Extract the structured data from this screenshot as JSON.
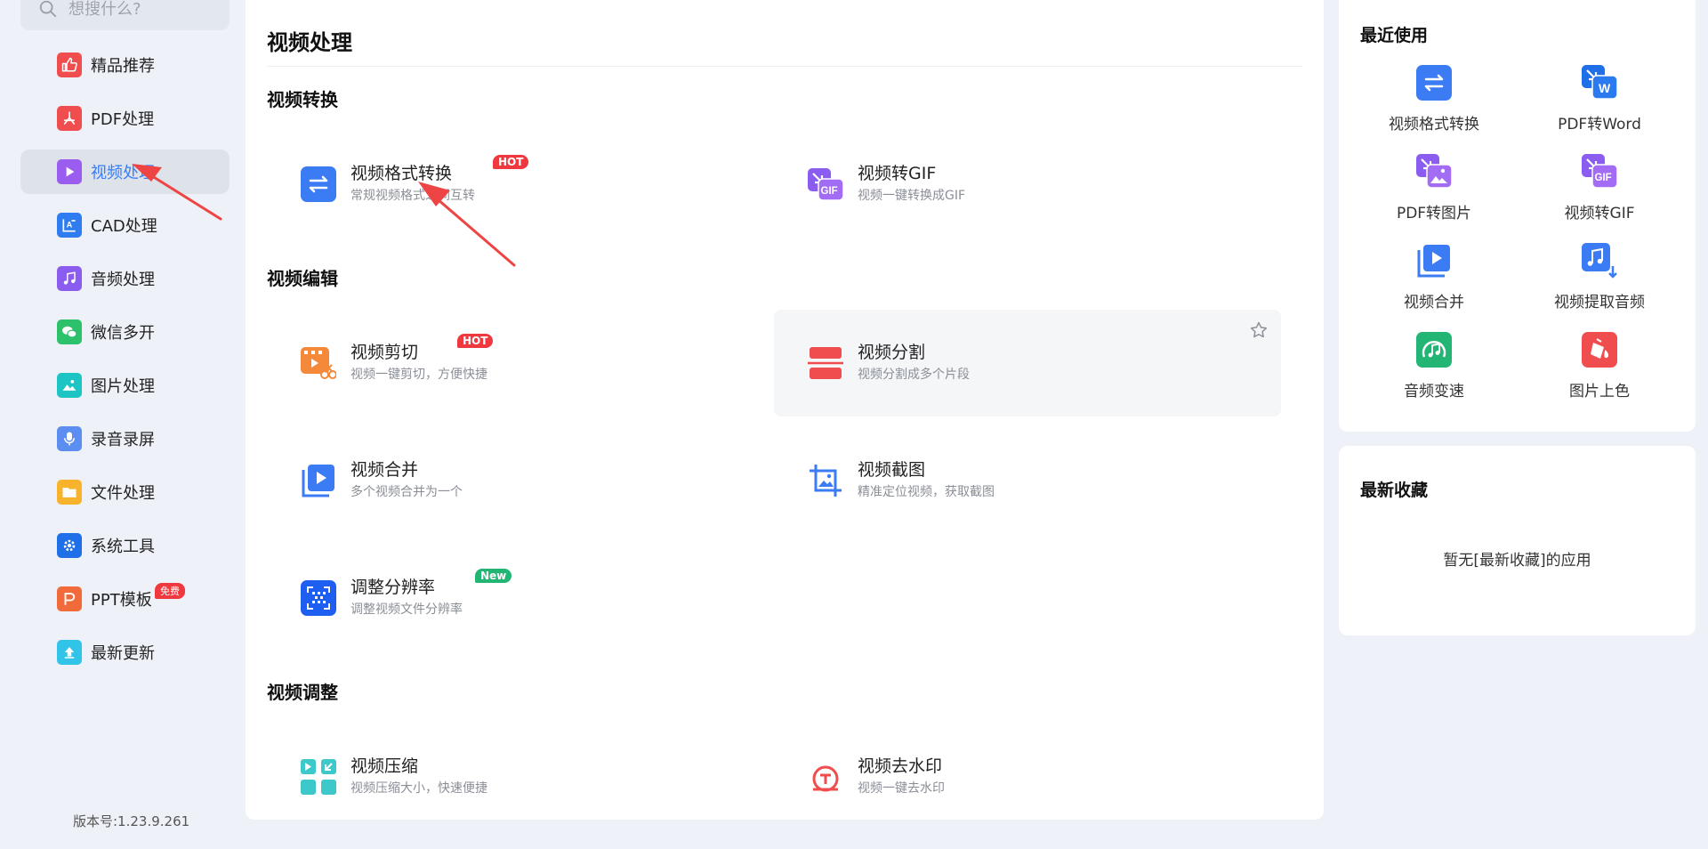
{
  "search": {
    "placeholder": "想搜什么?"
  },
  "sidebar": {
    "items": [
      {
        "label": "精品推荐",
        "icon": "thumbs-up-icon",
        "color": "#f04e4e"
      },
      {
        "label": "PDF处理",
        "icon": "pdf-icon",
        "color": "#f04e4e"
      },
      {
        "label": "视频处理",
        "icon": "play-icon",
        "color": "#9b5cf0",
        "active": true
      },
      {
        "label": "CAD处理",
        "icon": "cad-icon",
        "color": "#2f7cf0"
      },
      {
        "label": "音频处理",
        "icon": "music-icon",
        "color": "#8b5cf0"
      },
      {
        "label": "微信多开",
        "icon": "wechat-icon",
        "color": "#2cc16a"
      },
      {
        "label": "图片处理",
        "icon": "image-icon",
        "color": "#1dc4c4"
      },
      {
        "label": "录音录屏",
        "icon": "microphone-icon",
        "color": "#5b8ef0"
      },
      {
        "label": "文件处理",
        "icon": "folder-icon",
        "color": "#f7b32b"
      },
      {
        "label": "系统工具",
        "icon": "gear-icon",
        "color": "#1e6fe8"
      },
      {
        "label": "PPT模板",
        "icon": "ppt-icon",
        "color": "#f06a3a",
        "badge": "免费"
      },
      {
        "label": "最新更新",
        "icon": "upload-icon",
        "color": "#32c4e8"
      }
    ],
    "version": "版本号:1.23.9.261"
  },
  "main": {
    "title": "视频处理",
    "sections": [
      {
        "title": "视频转换"
      },
      {
        "title": "视频编辑"
      },
      {
        "title": "视频调整"
      }
    ],
    "tools": {
      "format_convert": {
        "name": "视频格式转换",
        "desc": "常规视频格式之间互转",
        "tag": "HOT"
      },
      "to_gif": {
        "name": "视频转GIF",
        "desc": "视频一键转换成GIF"
      },
      "cut": {
        "name": "视频剪切",
        "desc": "视频一键剪切，方便快捷",
        "tag": "HOT"
      },
      "split": {
        "name": "视频分割",
        "desc": "视频分割成多个片段"
      },
      "merge": {
        "name": "视频合并",
        "desc": "多个视频合并为一个"
      },
      "screenshot": {
        "name": "视频截图",
        "desc": "精准定位视频，获取截图"
      },
      "resolution": {
        "name": "调整分辨率",
        "desc": "调整视频文件分辨率",
        "tag": "New"
      },
      "compress": {
        "name": "视频压缩",
        "desc": "视频压缩大小，快速便捷"
      },
      "watermark": {
        "name": "视频去水印",
        "desc": "视频一键去水印"
      }
    }
  },
  "recent": {
    "title": "最近使用",
    "items": [
      {
        "label": "视频格式转换",
        "icon": "convert-icon"
      },
      {
        "label": "PDF转Word",
        "icon": "pdf-to-word-icon"
      },
      {
        "label": "PDF转图片",
        "icon": "pdf-to-image-icon"
      },
      {
        "label": "视频转GIF",
        "icon": "video-to-gif-icon"
      },
      {
        "label": "视频合并",
        "icon": "video-merge-icon"
      },
      {
        "label": "视频提取音频",
        "icon": "extract-audio-icon"
      },
      {
        "label": "音频变速",
        "icon": "audio-speed-icon"
      },
      {
        "label": "图片上色",
        "icon": "image-colorize-icon"
      }
    ]
  },
  "favorites": {
    "title": "最新收藏",
    "empty_text": "暂无[最新收藏]的应用"
  },
  "colors": {
    "accent": "#3b7cf5",
    "hot": "#f0383f",
    "new": "#22b573",
    "annotation_arrow": "#ef4444"
  }
}
